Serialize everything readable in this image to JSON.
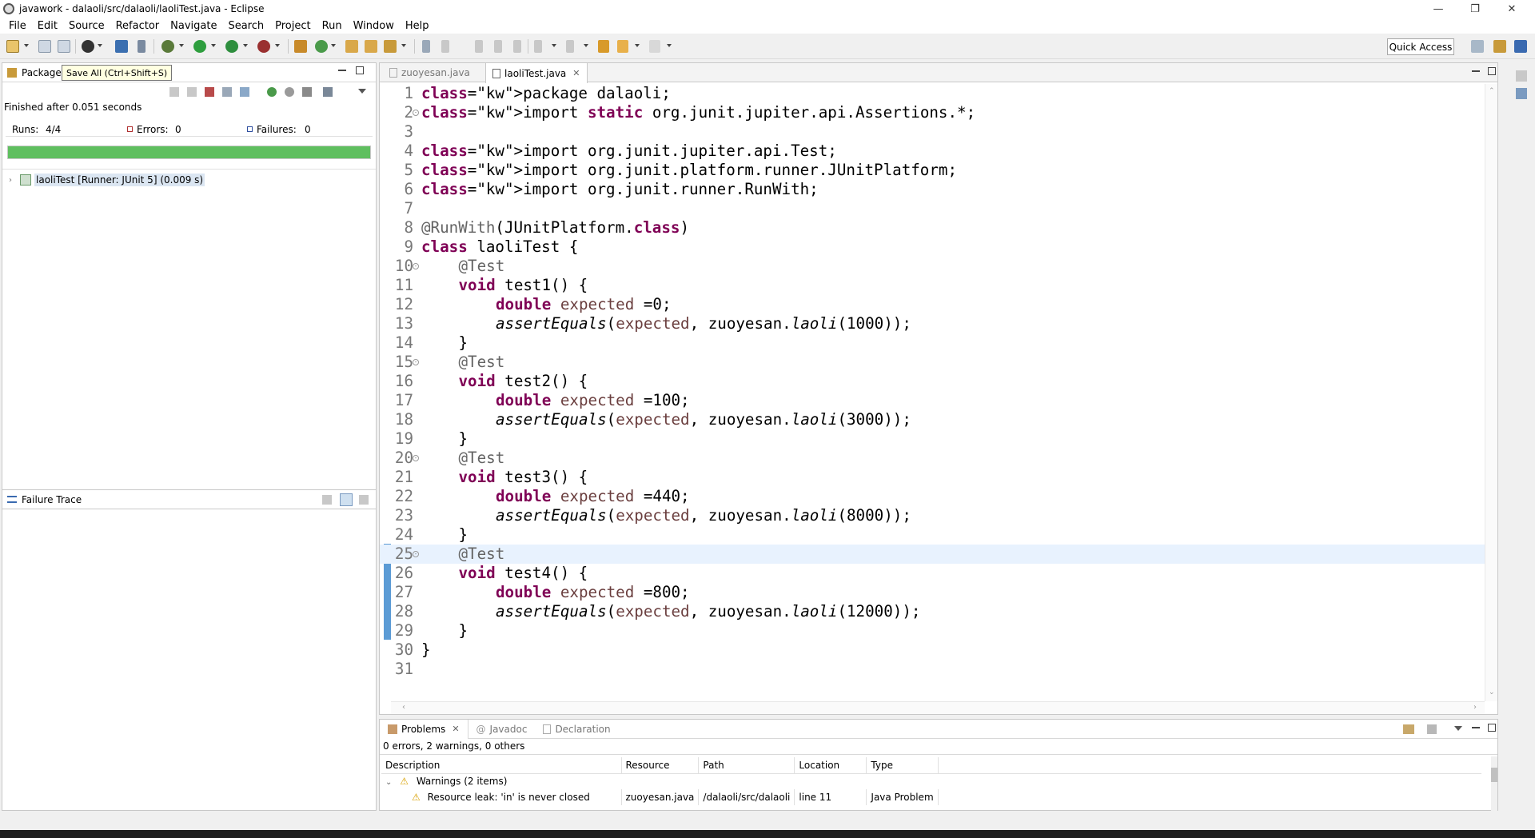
{
  "window": {
    "title": "javawork - dalaoli/src/dalaoli/laoliTest.java - Eclipse"
  },
  "menu": [
    "File",
    "Edit",
    "Source",
    "Refactor",
    "Navigate",
    "Search",
    "Project",
    "Run",
    "Window",
    "Help"
  ],
  "toolbar": {
    "quick_access": "Quick Access",
    "tooltip": "Save All (Ctrl+Shift+S)"
  },
  "junit": {
    "tab_label": "Package",
    "finished": "Finished after 0.051 seconds",
    "runs_label": "Runs:",
    "runs_value": "4/4",
    "errors_label": "Errors:",
    "errors_value": "0",
    "failures_label": "Failures:",
    "failures_value": "0",
    "progress": 1.0,
    "bar_color": "#5fbf5f",
    "tree_item": "laoliTest [Runner: JUnit 5] (0.009 s)"
  },
  "failure_trace": {
    "title": "Failure Trace"
  },
  "editor": {
    "tabs": [
      {
        "label": "zuoyesan.java",
        "active": false
      },
      {
        "label": "laoliTest.java",
        "active": true
      }
    ],
    "lines": [
      "1",
      "2",
      "3",
      "4",
      "5",
      "6",
      "7",
      "8",
      "9",
      "10",
      "11",
      "12",
      "13",
      "14",
      "15",
      "16",
      "17",
      "18",
      "19",
      "20",
      "21",
      "22",
      "23",
      "24",
      "25",
      "26",
      "27",
      "28",
      "29",
      "30",
      "31"
    ],
    "code": {
      "l1": "package dalaoli;",
      "l2": "import static org.junit.jupiter.api.Assertions.*;",
      "l4": "import org.junit.jupiter.api.Test;",
      "l5": "import org.junit.platform.runner.JUnitPlatform;",
      "l6": "import org.junit.runner.RunWith;",
      "l8": "@RunWith(JUnitPlatform.class)",
      "l9": "class laoliTest {",
      "test_ann": "@Test",
      "t1_sig": "void test1() {",
      "t1_decl": "double expected =0;",
      "t1_assert": "assertEquals(expected, zuoyesan.laoli(1000));",
      "t2_sig": "void test2() {",
      "t2_decl": "double expected =100;",
      "t2_assert": "assertEquals(expected, zuoyesan.laoli(3000));",
      "t3_sig": "void test3() {",
      "t3_decl": "double expected =440;",
      "t3_assert": "assertEquals(expected, zuoyesan.laoli(8000));",
      "t4_sig": "void test4() {",
      "t4_decl": "double expected =800;",
      "t4_assert": "assertEquals(expected, zuoyesan.laoli(12000));",
      "close_inner": "}",
      "close_outer": "}"
    }
  },
  "problems": {
    "tabs": [
      "Problems",
      "Javadoc",
      "Declaration"
    ],
    "summary": "0 errors, 2 warnings, 0 others",
    "columns": [
      "Description",
      "Resource",
      "Path",
      "Location",
      "Type"
    ],
    "group": "Warnings (2 items)",
    "rows": [
      {
        "description": "Resource leak: 'in' is never closed",
        "resource": "zuoyesan.java",
        "path": "/dalaoli/src/dalaoli",
        "location": "line 11",
        "type": "Java Problem"
      }
    ]
  }
}
